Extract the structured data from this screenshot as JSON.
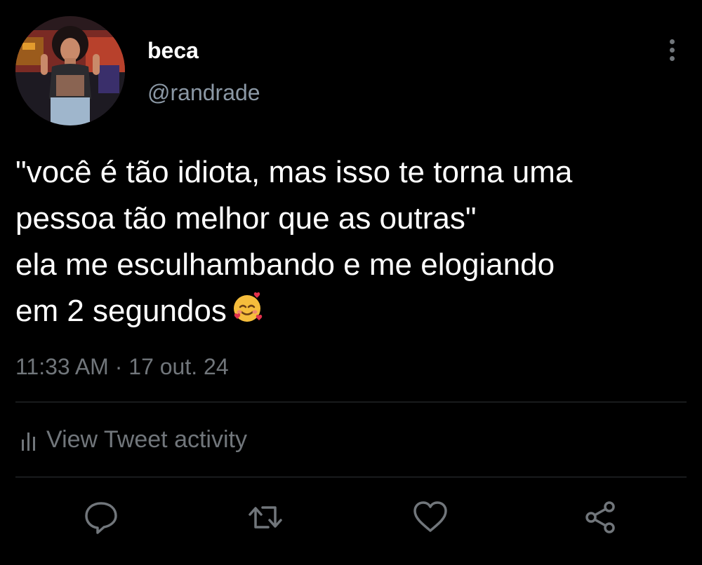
{
  "user": {
    "display_name": "beca",
    "handle": "@randrade",
    "avatar": "profile-photo"
  },
  "tweet": {
    "text": "\"você é tão idiota, mas isso te torna uma\npessoa tão melhor que as outras\"\nela me esculhambando e me elogiando\nem 2 segundos",
    "emoji": "🥰",
    "time": "11:33 AM",
    "separator": "·",
    "date": "17 out. 24"
  },
  "activity": {
    "label": "View Tweet activity",
    "icon": "bar-chart-icon"
  },
  "actions": [
    {
      "name": "reply",
      "icon": "speech-bubble-icon"
    },
    {
      "name": "retweet",
      "icon": "retweet-icon"
    },
    {
      "name": "like",
      "icon": "heart-icon"
    },
    {
      "name": "share",
      "icon": "share-icon"
    }
  ],
  "menu": {
    "icon": "vertical-dots-icon"
  },
  "colors": {
    "background": "#000000",
    "text": "#ffffff",
    "secondary": "#71767b",
    "divider": "#2f3336"
  }
}
